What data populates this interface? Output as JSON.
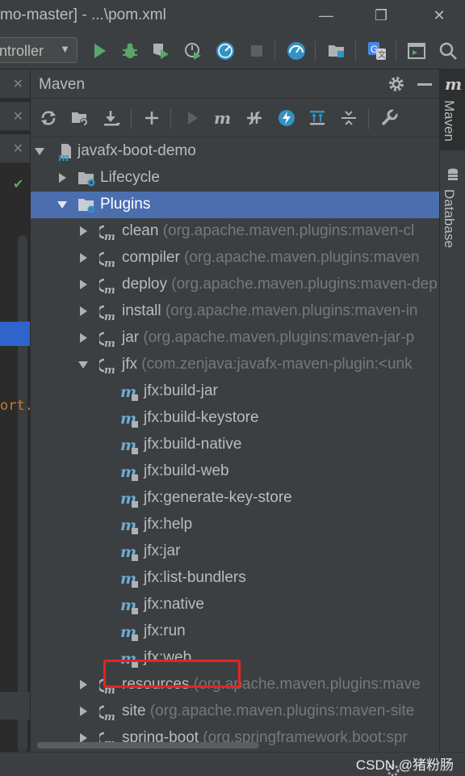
{
  "window": {
    "title": "mo-master] - ...\\pom.xml",
    "minimize_glyph": "—",
    "restore_glyph": "❐",
    "close_glyph": "✕"
  },
  "toolbar": {
    "run_config": "ntroller",
    "run_config_caret": "▼",
    "icons": [
      "run-icon",
      "debug-icon",
      "coverage-icon",
      "profile-icon",
      "timer-icon",
      "stop-icon",
      "speed-icon",
      "project-structure-icon",
      "translate-icon",
      "terminal-icon",
      "search-icon"
    ]
  },
  "editor_strip": {
    "close_glyph": "✕",
    "code_fragment": "ort.",
    "check_glyph": "✔"
  },
  "maven_panel": {
    "title": "Maven",
    "tools": [
      "reload-icon",
      "add-folder-icon",
      "download-icon",
      "add-icon",
      "run-icon",
      "maven-goal-icon",
      "toggle-offline-icon",
      "skip-tests-icon",
      "show-dependencies-icon",
      "collapse-all-icon",
      "settings-wrench-icon"
    ],
    "tree": {
      "root": "javafx-boot-demo",
      "lifecycle": "Lifecycle",
      "plugins": "Plugins",
      "plugin_items": [
        {
          "name": "clean",
          "detail": "(org.apache.maven.plugins:maven-cl"
        },
        {
          "name": "compiler",
          "detail": "(org.apache.maven.plugins:maven"
        },
        {
          "name": "deploy",
          "detail": "(org.apache.maven.plugins:maven-dep"
        },
        {
          "name": "install",
          "detail": "(org.apache.maven.plugins:maven-in"
        },
        {
          "name": "jar",
          "detail": "(org.apache.maven.plugins:maven-jar-p"
        },
        {
          "name": "jfx",
          "detail": "(com.zenjava:javafx-maven-plugin:<unk"
        }
      ],
      "jfx_goals": [
        "jfx:build-jar",
        "jfx:build-keystore",
        "jfx:build-native",
        "jfx:build-web",
        "jfx:generate-key-store",
        "jfx:help",
        "jfx:jar",
        "jfx:list-bundlers",
        "jfx:native",
        "jfx:run",
        "jfx:web"
      ],
      "more_plugins": [
        {
          "name": "resources",
          "detail": "(org.apache.maven.plugins:mave"
        },
        {
          "name": "site",
          "detail": "(org.apache.maven.plugins:maven-site"
        },
        {
          "name": "spring-boot",
          "detail": "(org.springframework.boot:spr"
        }
      ],
      "highlighted_goal": "jfx:native"
    }
  },
  "right_strip": {
    "maven_tab": "Maven",
    "database_tab": "Database"
  },
  "watermark": "CSDN @猪粉肠",
  "colors": {
    "selection": "#4b6eaf",
    "highlight_border": "#e8231f",
    "run_green": "#59a869",
    "accent_blue": "#3592c4"
  }
}
